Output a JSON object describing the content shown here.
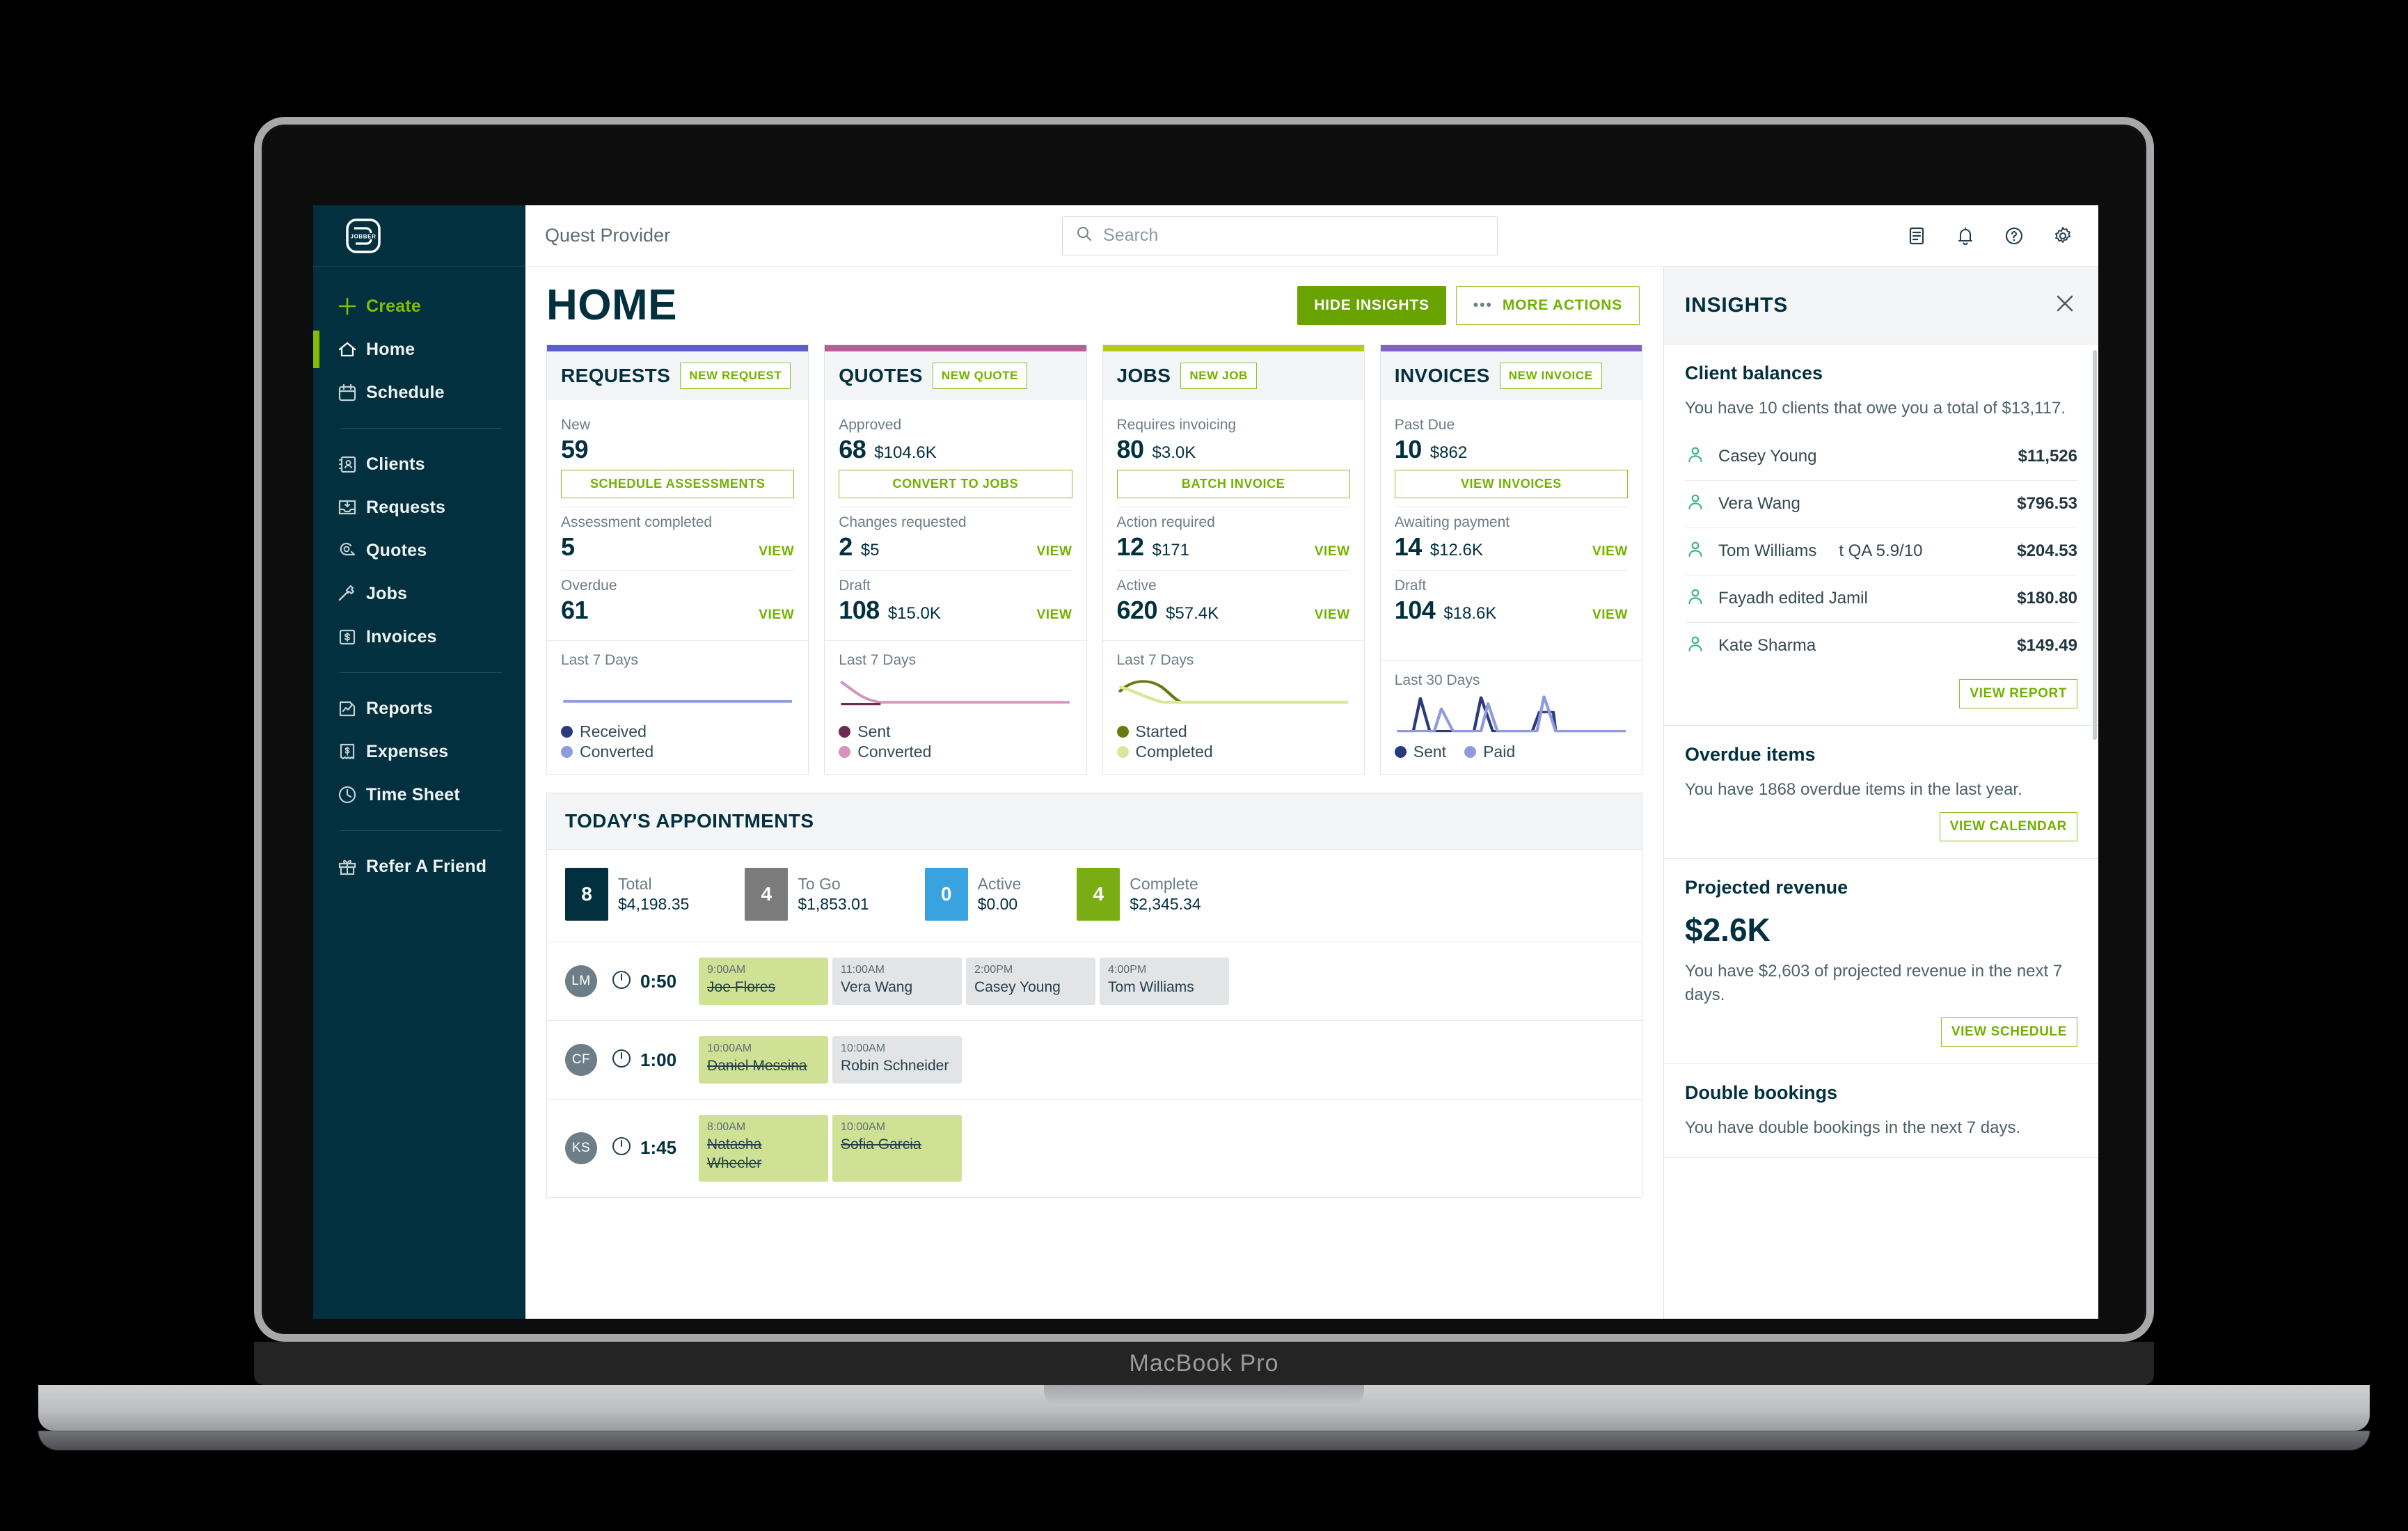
{
  "device": {
    "label": "MacBook Pro"
  },
  "sidebar": {
    "logo_name": "jobber-logo",
    "items": [
      {
        "label": "Create",
        "icon": "plus-icon",
        "name": "create"
      },
      {
        "label": "Home",
        "icon": "home-icon",
        "name": "home"
      },
      {
        "label": "Schedule",
        "icon": "calendar-icon",
        "name": "schedule"
      },
      {
        "label": "Clients",
        "icon": "contacts-icon",
        "name": "clients"
      },
      {
        "label": "Requests",
        "icon": "inbox-icon",
        "name": "requests"
      },
      {
        "label": "Quotes",
        "icon": "tape-icon",
        "name": "quotes"
      },
      {
        "label": "Jobs",
        "icon": "hammer-icon",
        "name": "jobs"
      },
      {
        "label": "Invoices",
        "icon": "dollar-doc-icon",
        "name": "invoices"
      },
      {
        "label": "Reports",
        "icon": "chart-doc-icon",
        "name": "reports"
      },
      {
        "label": "Expenses",
        "icon": "receipt-icon",
        "name": "expenses"
      },
      {
        "label": "Time Sheet",
        "icon": "clock-icon",
        "name": "time-sheet"
      },
      {
        "label": "Refer A Friend",
        "icon": "gift-icon",
        "name": "refer-a-friend"
      }
    ]
  },
  "topbar": {
    "org_name": "Quest Provider",
    "search_placeholder": "Search",
    "icons": [
      "notes-icon",
      "bell-icon",
      "help-icon",
      "gear-icon"
    ]
  },
  "page": {
    "title": "HOME",
    "hide_insights_label": "HIDE INSIGHTS",
    "more_actions_label": "MORE ACTIONS"
  },
  "cards": [
    {
      "title": "REQUESTS",
      "accent": "#5b5fc7",
      "new_label": "NEW REQUEST",
      "stats": [
        {
          "label": "New",
          "number": "59",
          "amount": "",
          "cta": "SCHEDULE ASSESSMENTS",
          "view": ""
        },
        {
          "label": "Assessment completed",
          "number": "5",
          "amount": "",
          "cta": "",
          "view": "VIEW"
        },
        {
          "label": "Overdue",
          "number": "61",
          "amount": "",
          "cta": "",
          "view": "VIEW"
        }
      ],
      "foot_label": "Last 7 Days",
      "legend": [
        {
          "label": "Received",
          "color": "#2b3a7a"
        },
        {
          "label": "Converted",
          "color": "#8f9ae0"
        }
      ],
      "legend_layout": "column"
    },
    {
      "title": "QUOTES",
      "accent": "#b4609a",
      "new_label": "NEW QUOTE",
      "stats": [
        {
          "label": "Approved",
          "number": "68",
          "amount": "$104.6K",
          "cta": "CONVERT TO JOBS",
          "view": ""
        },
        {
          "label": "Changes requested",
          "number": "2",
          "amount": "$5",
          "cta": "",
          "view": "VIEW"
        },
        {
          "label": "Draft",
          "number": "108",
          "amount": "$15.0K",
          "cta": "",
          "view": "VIEW"
        }
      ],
      "foot_label": "Last 7 Days",
      "legend": [
        {
          "label": "Sent",
          "color": "#6e2b50"
        },
        {
          "label": "Converted",
          "color": "#d693bd"
        }
      ],
      "legend_layout": "column"
    },
    {
      "title": "JOBS",
      "accent": "#b5cc18",
      "new_label": "NEW JOB",
      "stats": [
        {
          "label": "Requires invoicing",
          "number": "80",
          "amount": "$3.0K",
          "cta": "BATCH INVOICE",
          "view": ""
        },
        {
          "label": "Action required",
          "number": "12",
          "amount": "$171",
          "cta": "",
          "view": "VIEW"
        },
        {
          "label": "Active",
          "number": "620",
          "amount": "$57.4K",
          "cta": "",
          "view": "VIEW"
        }
      ],
      "foot_label": "Last 7 Days",
      "legend": [
        {
          "label": "Started",
          "color": "#6b7a10"
        },
        {
          "label": "Completed",
          "color": "#dde59a"
        }
      ],
      "legend_layout": "column"
    },
    {
      "title": "INVOICES",
      "accent": "#8262c0",
      "new_label": "NEW INVOICE",
      "stats": [
        {
          "label": "Past Due",
          "number": "10",
          "amount": "$862",
          "cta": "VIEW INVOICES",
          "view": ""
        },
        {
          "label": "Awaiting payment",
          "number": "14",
          "amount": "$12.6K",
          "cta": "",
          "view": "VIEW"
        },
        {
          "label": "Draft",
          "number": "104",
          "amount": "$18.6K",
          "cta": "",
          "view": "VIEW"
        }
      ],
      "foot_label": "Last 30 Days",
      "legend": [
        {
          "label": "Sent",
          "color": "#2b3a7a"
        },
        {
          "label": "Paid",
          "color": "#8f9ae0"
        }
      ],
      "legend_layout": "row"
    }
  ],
  "appointments": {
    "header": "TODAY'S APPOINTMENTS",
    "summary": [
      {
        "count": "8",
        "label": "Total",
        "amount": "$4,198.35",
        "color": "#02303f"
      },
      {
        "count": "4",
        "label": "To Go",
        "amount": "$1,853.01",
        "color": "#7b7b7b"
      },
      {
        "count": "0",
        "label": "Active",
        "amount": "$0.00",
        "color": "#39a3e0"
      },
      {
        "count": "4",
        "label": "Complete",
        "amount": "$2,345.34",
        "color": "#7aad14"
      }
    ],
    "rows": [
      {
        "initials": "LM",
        "duration": "0:50",
        "blocks": [
          {
            "time": "9:00AM",
            "name": "Joe Flores",
            "state": "done"
          },
          {
            "time": "11:00AM",
            "name": "Vera Wang",
            "state": "todo"
          },
          {
            "time": "2:00PM",
            "name": "Casey Young",
            "state": "todo"
          },
          {
            "time": "4:00PM",
            "name": "Tom Williams",
            "state": "todo"
          }
        ]
      },
      {
        "initials": "CF",
        "duration": "1:00",
        "blocks": [
          {
            "time": "10:00AM",
            "name": "Daniel Messina",
            "state": "done"
          },
          {
            "time": "10:00AM",
            "name": "Robin Schneider",
            "state": "todo"
          }
        ]
      },
      {
        "initials": "KS",
        "duration": "1:45",
        "blocks": [
          {
            "time": "8:00AM",
            "name": "Natasha Wheeler",
            "state": "done"
          },
          {
            "time": "10:00AM",
            "name": "Sofia Garcia",
            "state": "done"
          }
        ]
      }
    ]
  },
  "insights": {
    "title": "INSIGHTS",
    "client_balances": {
      "heading": "Client balances",
      "text": "You have 10 clients that owe you a total of $13,117.",
      "rows": [
        {
          "name": "Casey Young",
          "sub": "",
          "amount": "$11,526"
        },
        {
          "name": "Vera Wang",
          "sub": "",
          "amount": "$796.53"
        },
        {
          "name": "Tom Williams",
          "sub": "t QA 5.9/10",
          "amount": "$204.53"
        },
        {
          "name": "Fayadh edited Jamil",
          "sub": "",
          "amount": "$180.80"
        },
        {
          "name": "Kate Sharma",
          "sub": "",
          "amount": "$149.49"
        }
      ],
      "button": "VIEW REPORT"
    },
    "overdue_items": {
      "heading": "Overdue items",
      "text": "You have 1868 overdue items in the last year.",
      "button": "VIEW CALENDAR"
    },
    "projected_revenue": {
      "heading": "Projected revenue",
      "big": "$2.6K",
      "text": "You have $2,603 of projected revenue in the next 7 days.",
      "button": "VIEW SCHEDULE"
    },
    "double_bookings": {
      "heading": "Double bookings",
      "text": "You have double bookings in the next 7 days."
    }
  }
}
